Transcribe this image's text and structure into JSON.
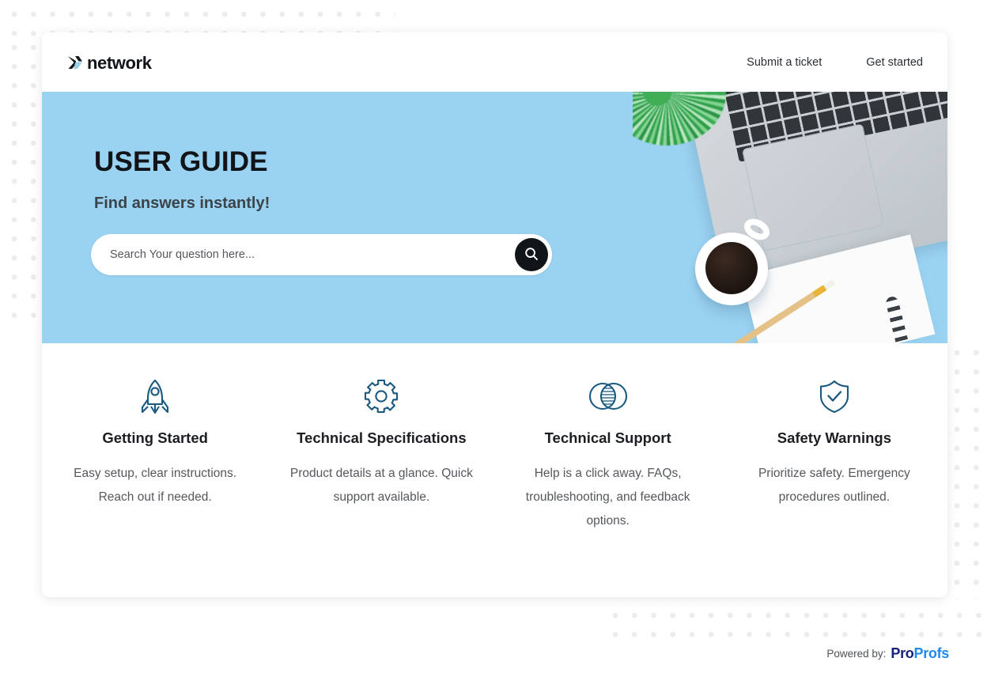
{
  "nav": {
    "logo_text": "network",
    "logo_icon": "x-network-logo-icon",
    "links": [
      {
        "label": "Submit a ticket"
      },
      {
        "label": "Get started"
      }
    ]
  },
  "hero": {
    "title": "USER GUIDE",
    "subtitle": "Find answers instantly!",
    "background_color": "#9ad2f2",
    "search": {
      "placeholder": "Search Your question here...",
      "value": "",
      "button_icon": "search-icon",
      "button_color": "#111418"
    },
    "image_alt": "Flat-lay desk photo with laptop, coffee cup, pencil, notebook and plant"
  },
  "features": [
    {
      "icon": "rocket-icon",
      "title": "Getting Started",
      "description": "Easy setup, clear instructions. Reach out if needed."
    },
    {
      "icon": "gear-icon",
      "title": "Technical Specifications",
      "description": "Product details at a glance. Quick support available."
    },
    {
      "icon": "venn-circles-icon",
      "title": "Technical Support",
      "description": "Help is a click away. FAQs, troubleshooting, and feedback options."
    },
    {
      "icon": "shield-check-icon",
      "title": "Safety Warnings",
      "description": "Prioritize safety. Emergency procedures outlined."
    }
  ],
  "footer": {
    "powered_by_label": "Powered by:",
    "brand_part1": "Pro",
    "brand_part2": "Profs",
    "brand_color1": "#16207a",
    "brand_color2": "#1f8af0"
  },
  "theme": {
    "icon_color": "#1b5a80",
    "accent": "#9ad2f2"
  }
}
